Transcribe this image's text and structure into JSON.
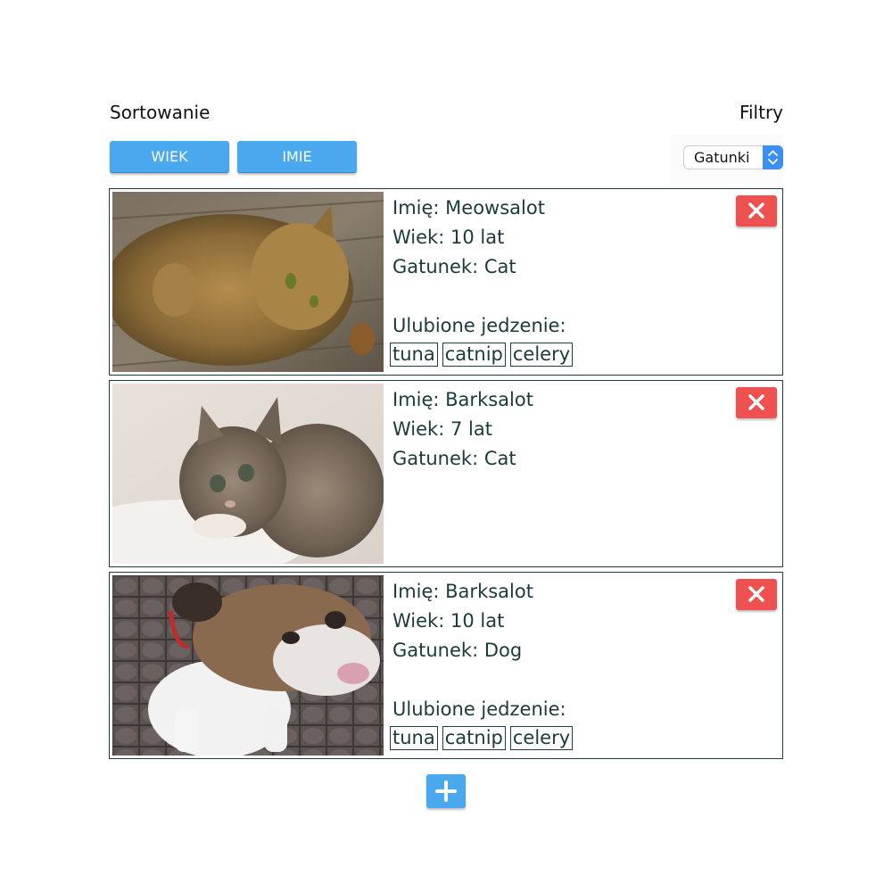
{
  "sorting": {
    "title": "Sortowanie",
    "buttons": [
      {
        "label": "WIEK"
      },
      {
        "label": "IMIE"
      }
    ]
  },
  "filters": {
    "title": "Filtry",
    "species_select": {
      "selected": "Gatunki"
    }
  },
  "pets": [
    {
      "name_line": "Imię: Meowsalot",
      "age_line": "Wiek: 10 lat",
      "species_line": "Gatunek: Cat",
      "favorite_food_label": "Ulubione jedzenie:",
      "favorite_foods": [
        "tuna",
        "catnip",
        "celery"
      ],
      "photo_subject": "tabby-cat-lying-on-wood"
    },
    {
      "name_line": "Imię: Barksalot",
      "age_line": "Wiek: 7 lat",
      "species_line": "Gatunek: Cat",
      "photo_subject": "fluffy-kitten"
    },
    {
      "name_line": "Imię: Barksalot",
      "age_line": "Wiek: 10 lat",
      "species_line": "Gatunek: Dog",
      "favorite_food_label": "Ulubione jedzenie:",
      "favorite_foods": [
        "tuna",
        "catnip",
        "celery"
      ],
      "photo_subject": "english-bulldog"
    }
  ],
  "icons": {
    "delete": "close-x-icon",
    "add": "plus-icon",
    "select_arrows": "up-down-chevron-icon"
  },
  "colors": {
    "primary_button": "#4aa8ee",
    "delete_button": "#ef5050",
    "text": "#1b3a3a",
    "card_border": "#1f3f3f",
    "select_arrow_bg": "#3c8ff5"
  }
}
